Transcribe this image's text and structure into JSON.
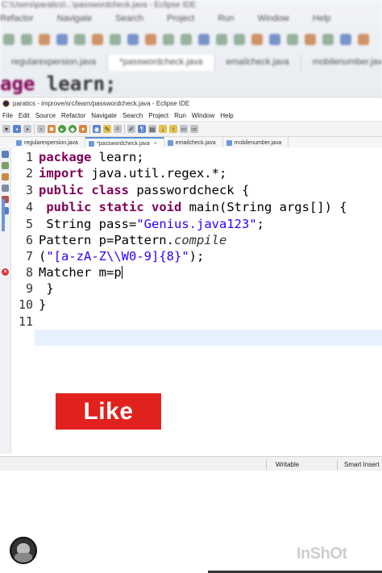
{
  "background": {
    "title": "C:\\Users\\paratics\\...\\passwordcheck.java - Eclipse IDE",
    "menu": [
      "Refactor",
      "Navigate",
      "Search",
      "Project",
      "Run",
      "Window",
      "Help"
    ],
    "tabs": [
      "regularexpersion.java",
      "*passwordcheck.java",
      "emailcheck.java",
      "mobilenumber.java"
    ],
    "code_fragment_kw": "age",
    "code_fragment_rest": " learn;"
  },
  "window": {
    "title": "paratics - improve/src/learn/passwordcheck.java - Eclipse IDE",
    "menu": [
      "File",
      "Edit",
      "Source",
      "Refactor",
      "Navigate",
      "Search",
      "Project",
      "Run",
      "Window",
      "Help"
    ],
    "tabs": [
      {
        "label": "regularexpersion.java",
        "active": false
      },
      {
        "label": "*passwordcheck.java",
        "active": true
      },
      {
        "label": "emailcheck.java",
        "active": false
      },
      {
        "label": "mobilenumber.java",
        "active": false
      }
    ]
  },
  "editor": {
    "line_numbers": [
      "1",
      "2",
      "3",
      "4",
      "5",
      "6",
      "7",
      "8",
      "9",
      "10",
      "11"
    ],
    "lines": {
      "l1_kw": "package",
      "l1_rest": " learn;",
      "l2_kw": "import",
      "l2_rest": " java.util.regex.*;",
      "l3_kw": "public class",
      "l3_rest": " passwordcheck {",
      "l4_kw": "public static void",
      "l4_rest": " main(String args[]) {",
      "l5_a": " String pass=",
      "l5_str": "\"Genius.java123\"",
      "l5_b": ";",
      "l6_a": "Pattern p=Pattern.",
      "l6_method": "compile",
      "l7_a": "(",
      "l7_str": "\"[a-zA-Z\\\\W0-9]{8}\"",
      "l7_b": ");",
      "l8": "Matcher m=p",
      "l9": " }",
      "l10": "}"
    }
  },
  "status": {
    "mode": "Writable",
    "insert": "Smart Insert"
  },
  "like_button": "Like",
  "watermark": "InShOt"
}
